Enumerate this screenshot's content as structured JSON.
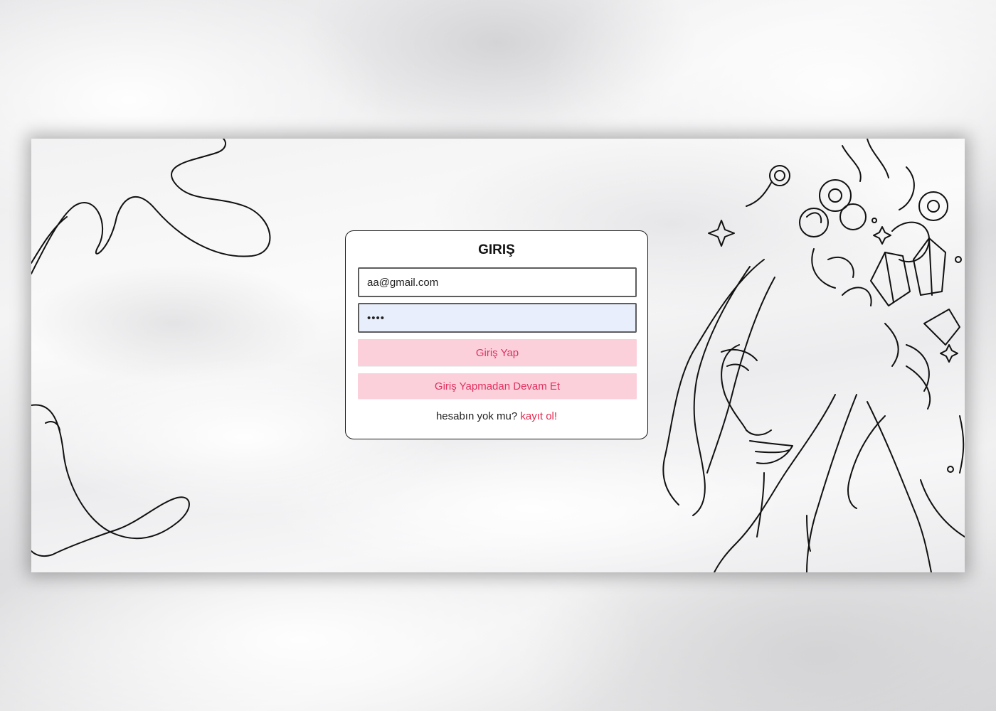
{
  "login_form": {
    "title": "GIRIŞ",
    "email_value": "aa@gmail.com",
    "password_value": "••••",
    "login_button_label": "Giriş Yap",
    "guest_button_label": "Giriş Yapmadan Devam Et",
    "signup_prompt": "hesabın yok mu?",
    "signup_link_label": "kayıt ol!"
  },
  "colors": {
    "button_background": "#fbd0db",
    "button_text": "#e0315f",
    "link": "#e6284f",
    "password_field_background": "#e8eefc"
  }
}
